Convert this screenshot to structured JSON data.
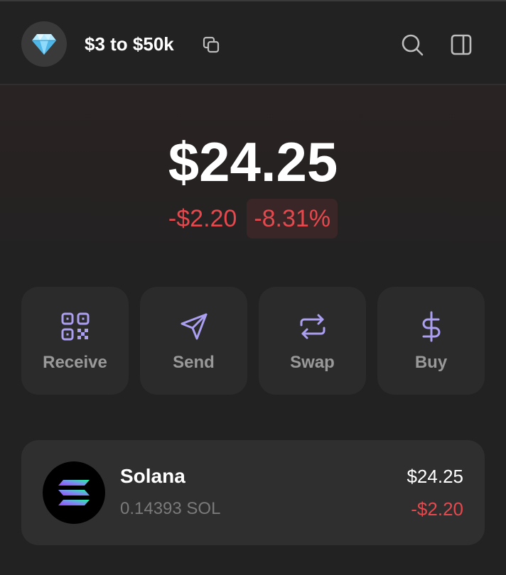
{
  "header": {
    "avatar_icon": "gem-icon",
    "account_name": "$3 to $50k",
    "copy_icon": "copy-icon",
    "search_icon": "search-icon",
    "panel_icon": "side-panel-icon"
  },
  "balance": {
    "total": "$24.25",
    "change_abs": "-$2.20",
    "change_pct": "-8.31%"
  },
  "actions": [
    {
      "label": "Receive",
      "icon": "qr-code-icon"
    },
    {
      "label": "Send",
      "icon": "send-icon"
    },
    {
      "label": "Swap",
      "icon": "swap-icon"
    },
    {
      "label": "Buy",
      "icon": "dollar-icon"
    }
  ],
  "tokens": [
    {
      "name": "Solana",
      "amount": "0.14393 SOL",
      "value": "$24.25",
      "change": "-$2.20",
      "icon": "solana-logo-icon"
    }
  ],
  "colors": {
    "accent": "#ab9ff2",
    "negative": "#e5484d",
    "background": "#222222",
    "card": "#2b2b2b"
  }
}
